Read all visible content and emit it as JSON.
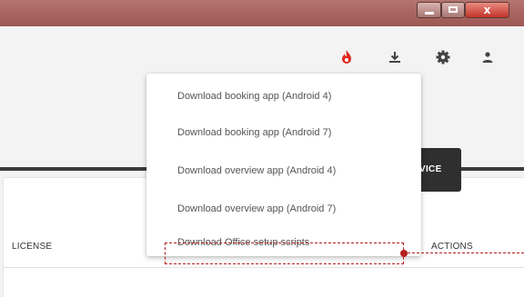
{
  "window": {
    "close_glyph": "x"
  },
  "toolbar": {
    "icons": [
      "fire-icon",
      "download-icon",
      "gear-icon",
      "user-icon"
    ],
    "fire_color": "#e0281e"
  },
  "download_menu": {
    "items": [
      {
        "label": "Download booking app (Android 4)"
      },
      {
        "label": "Download booking app (Android 7)"
      },
      {
        "label": "Download overview app (Android 4)"
      },
      {
        "label": "Download overview app (Android 7)"
      },
      {
        "label": "Download Office setup scripts"
      }
    ],
    "highlighted_index": 4,
    "highlight_color": "#b51f1f"
  },
  "service_button": {
    "label": "VICE"
  },
  "table": {
    "columns": {
      "license": "LICENSE",
      "actions": "ACTIONS"
    }
  }
}
